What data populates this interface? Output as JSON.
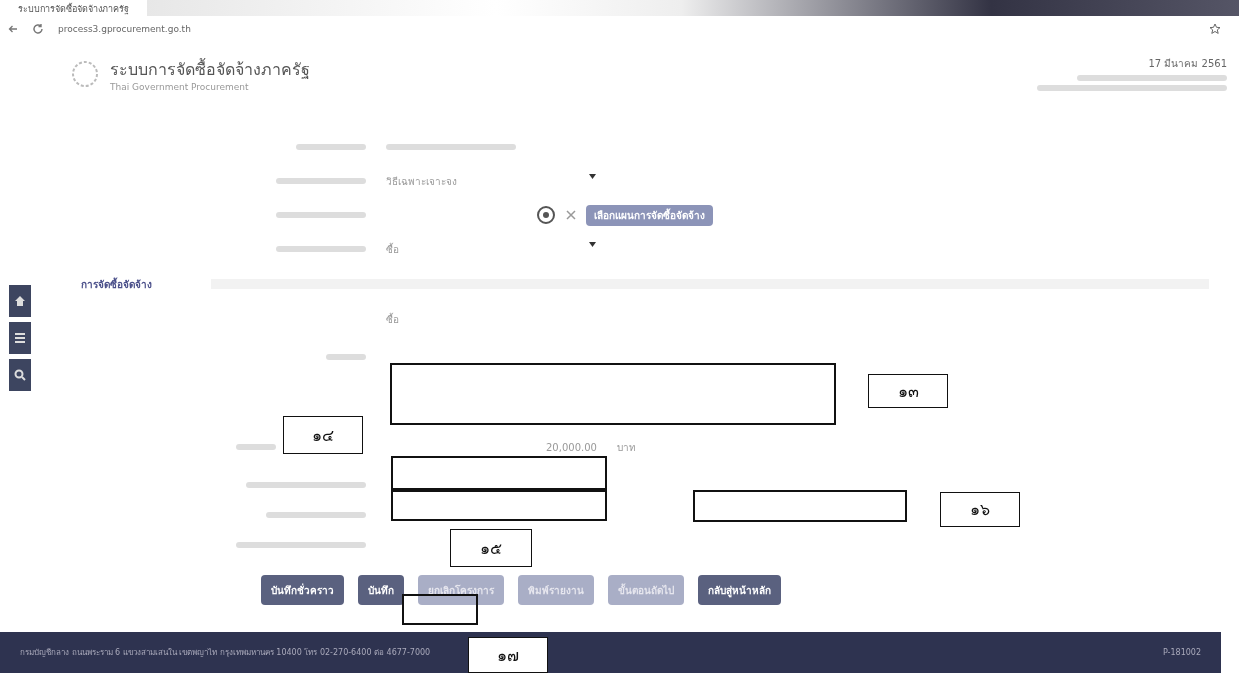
{
  "browser": {
    "tab_title": "ระบบการจัดซื้อจัดจ้างภาครัฐ",
    "url": "process3.gprocurement.go.th"
  },
  "header": {
    "title": "ระบบการจัดซื้อจัดจ้างภาครัฐ",
    "subtitle": "Thai Government Procurement",
    "date": "17 มีนาคม 2561"
  },
  "sidebar": [
    {
      "kind": "home"
    },
    {
      "kind": "menu"
    },
    {
      "kind": "search"
    }
  ],
  "form_rows": [
    {
      "kind": "select",
      "value": "วิธีเฉพาะเจาะจง"
    },
    {
      "kind": "plan",
      "button": "เลือกแผนการจัดซื้อจัดจ้าง"
    },
    {
      "kind": "select",
      "value": "ซื้อ"
    }
  ],
  "section": {
    "title": "การจัดซื้อจัดจ้าง",
    "type_value": "ซื้อ"
  },
  "project": {
    "amount": "20,000.00",
    "unit": "บาท"
  },
  "buttons": [
    {
      "label": "บันทึกชั่วคราว",
      "disabled": false
    },
    {
      "label": "บันทึก",
      "disabled": false
    },
    {
      "label": "ยกเลิกโครงการ",
      "disabled": true
    },
    {
      "label": "พิมพ์รายงาน",
      "disabled": true
    },
    {
      "label": "ขั้นตอนถัดไป",
      "disabled": true
    },
    {
      "label": "กลับสู่หน้าหลัก",
      "disabled": false
    }
  ],
  "footer": {
    "text": "กรมบัญชีกลาง ถนนพระราม 6 แขวงสามเสนใน เขตพญาไท กรุงเทพมหานคร 10400 โทร 02-270-6400 ต่อ 4677-7000",
    "version": "P-181002"
  },
  "callouts": [
    {
      "label": "๑๓"
    },
    {
      "label": "๑๔"
    },
    {
      "label": "๑๕"
    },
    {
      "label": "๑๖"
    },
    {
      "label": "๑๗"
    }
  ]
}
